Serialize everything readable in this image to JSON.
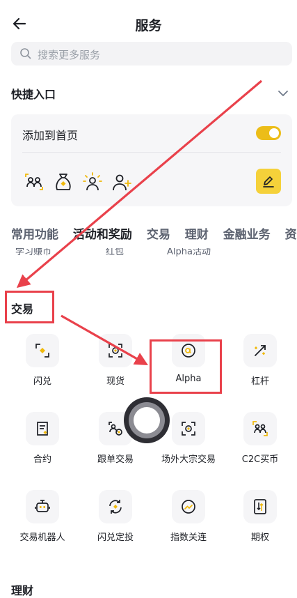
{
  "header": {
    "title": "服务"
  },
  "search": {
    "placeholder": "搜索更多服务"
  },
  "quick_entry": {
    "title": "快捷入口",
    "add_to_home_label": "添加到首页",
    "add_to_home_enabled": true,
    "icons": [
      "user-swap-icon",
      "money-bag-icon",
      "user-sun-icon",
      "user-add-icon"
    ]
  },
  "tabs": [
    "常用功能",
    "活动和奖励",
    "交易",
    "理财",
    "金融业务",
    "资"
  ],
  "clipped_row": [
    "学习赚币",
    "红包",
    "Alpha活动"
  ],
  "trade_section": {
    "title": "交易",
    "items": [
      {
        "label": "闪兑",
        "icon": "convert-icon"
      },
      {
        "label": "现货",
        "icon": "spot-icon"
      },
      {
        "label": "Alpha",
        "icon": "alpha-icon"
      },
      {
        "label": "杠杆",
        "icon": "margin-icon"
      },
      {
        "label": "合约",
        "icon": "futures-icon"
      },
      {
        "label": "跟单交易",
        "icon": "copy-trading-icon"
      },
      {
        "label": "场外大宗交易",
        "icon": "otc-block-icon"
      },
      {
        "label": "C2C买币",
        "icon": "c2c-icon"
      },
      {
        "label": "交易机器人",
        "icon": "trading-bot-icon"
      },
      {
        "label": "闪兑定投",
        "icon": "auto-invest-icon"
      },
      {
        "label": "指数关连",
        "icon": "index-link-icon"
      },
      {
        "label": "期权",
        "icon": "options-icon"
      }
    ]
  },
  "next_section": {
    "title": "理财"
  },
  "colors": {
    "accent": "#ecbd18",
    "annotation": "#e9414b"
  }
}
